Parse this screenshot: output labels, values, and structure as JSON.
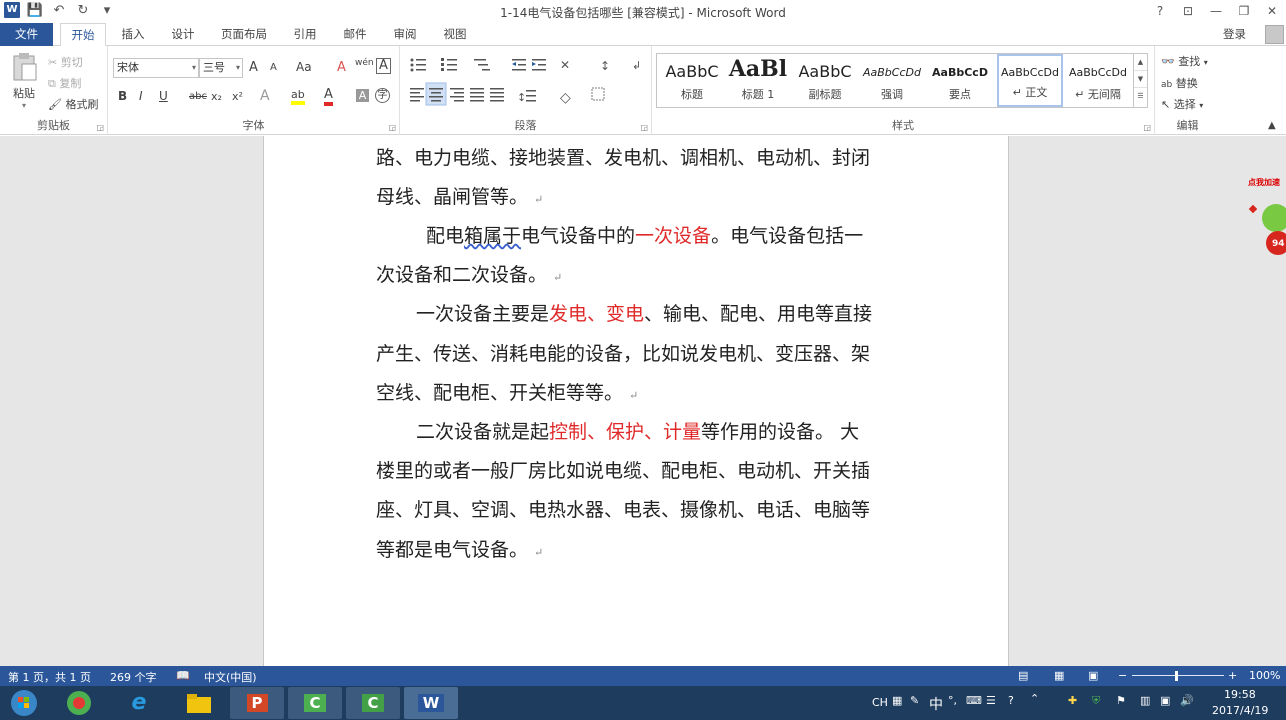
{
  "window": {
    "title": "1-14电气设备包括哪些 [兼容模式] - Microsoft Word",
    "qat": {
      "word_logo": "W",
      "save": "💾",
      "undo": "↶",
      "redo": "↻",
      "customize": "▾"
    },
    "controls": {
      "help": "?",
      "ribbon_display": "⊡",
      "minimize": "—",
      "restore": "❐",
      "close": "✕"
    }
  },
  "tabs": [
    {
      "label": "文件"
    },
    {
      "label": "开始"
    },
    {
      "label": "插入"
    },
    {
      "label": "设计"
    },
    {
      "label": "页面布局"
    },
    {
      "label": "引用"
    },
    {
      "label": "邮件"
    },
    {
      "label": "审阅"
    },
    {
      "label": "视图"
    }
  ],
  "account": {
    "login": "登录"
  },
  "ribbon": {
    "clipboard": {
      "label": "剪贴板",
      "paste": "粘贴",
      "cut": "剪切",
      "copy": "复制",
      "format_painter": "格式刷"
    },
    "font": {
      "label": "字体",
      "font_name": "宋体",
      "font_size": "三号",
      "grow": "A",
      "shrink": "A",
      "change_case": "Aa",
      "clear_format": "A",
      "phonetic": "wén",
      "border_char": "A",
      "bold": "B",
      "italic": "I",
      "underline": "U",
      "strike": "abc",
      "subscript": "x₂",
      "superscript": "x²",
      "text_effect": "A",
      "highlight": "ab",
      "font_color": "A",
      "char_shading": "A",
      "enclose": "字"
    },
    "paragraph": {
      "label": "段落"
    },
    "styles": {
      "label": "样式",
      "items": [
        {
          "sample": "AaBbC",
          "name": "标题"
        },
        {
          "sample": "AaBl",
          "name": "标题 1"
        },
        {
          "sample": "AaBbC",
          "name": "副标题"
        },
        {
          "sample": "AaBbCcDd",
          "name": "强调"
        },
        {
          "sample": "AaBbCcD",
          "name": "要点"
        },
        {
          "sample": "AaBbCcDd",
          "name": "↵ 正文"
        },
        {
          "sample": "AaBbCcDd",
          "name": "↵ 无间隔"
        }
      ]
    },
    "editing": {
      "label": "编辑",
      "find": "查找",
      "replace": "替换",
      "select": "选择"
    }
  },
  "document": {
    "lines": [
      [
        {
          "t": "路、电力电缆、接地装置、发电机、调相机、电动机、封闭"
        }
      ],
      [
        {
          "t": "母线、晶闸管等。"
        }
      ],
      [
        {
          "t": "配电"
        },
        {
          "t": "箱属于",
          "sq": true
        },
        {
          "t": "电气设备中的"
        },
        {
          "t": "一次设备",
          "red": true
        },
        {
          "t": "。电气设备包括一"
        }
      ],
      [
        {
          "t": "次设备和二次设备。"
        }
      ],
      [
        {
          "t": "一次设备主要是"
        },
        {
          "t": "发电、变电",
          "red": true
        },
        {
          "t": "、输电、配电、用电等直接"
        }
      ],
      [
        {
          "t": "产生、传送、消耗电能的设备，比如说发电机、变压器、架"
        }
      ],
      [
        {
          "t": "空线、配电柜、开关柜等等。"
        }
      ],
      [
        {
          "t": "二次设备就是起"
        },
        {
          "t": "控制、保护、计量",
          "red": true
        },
        {
          "t": "等作用的设备。 大"
        }
      ],
      [
        {
          "t": "楼里的或者一般厂房比如说电缆、配电柜、电动机、开关插"
        }
      ],
      [
        {
          "t": "座、灯具、空调、电热水器、电表、摄像机、电话、电脑等"
        }
      ],
      [
        {
          "t": "等都是电气设备。"
        }
      ]
    ],
    "paragraph_mark": "↵"
  },
  "ad_badge": {
    "text": "点我加速",
    "value": "94"
  },
  "status": {
    "page": "第 1 页，共 1 页",
    "words": "269 个字",
    "language": "中文(中国)",
    "zoom": "100%"
  },
  "taskbar": {
    "clock_time": "19:58",
    "clock_date": "2017/4/19",
    "ime": "CH",
    "ime_mode": "中"
  },
  "colors": {
    "accent": "#2b579a",
    "red_text": "#e02a2a",
    "taskbar": "#1d3c5e"
  }
}
